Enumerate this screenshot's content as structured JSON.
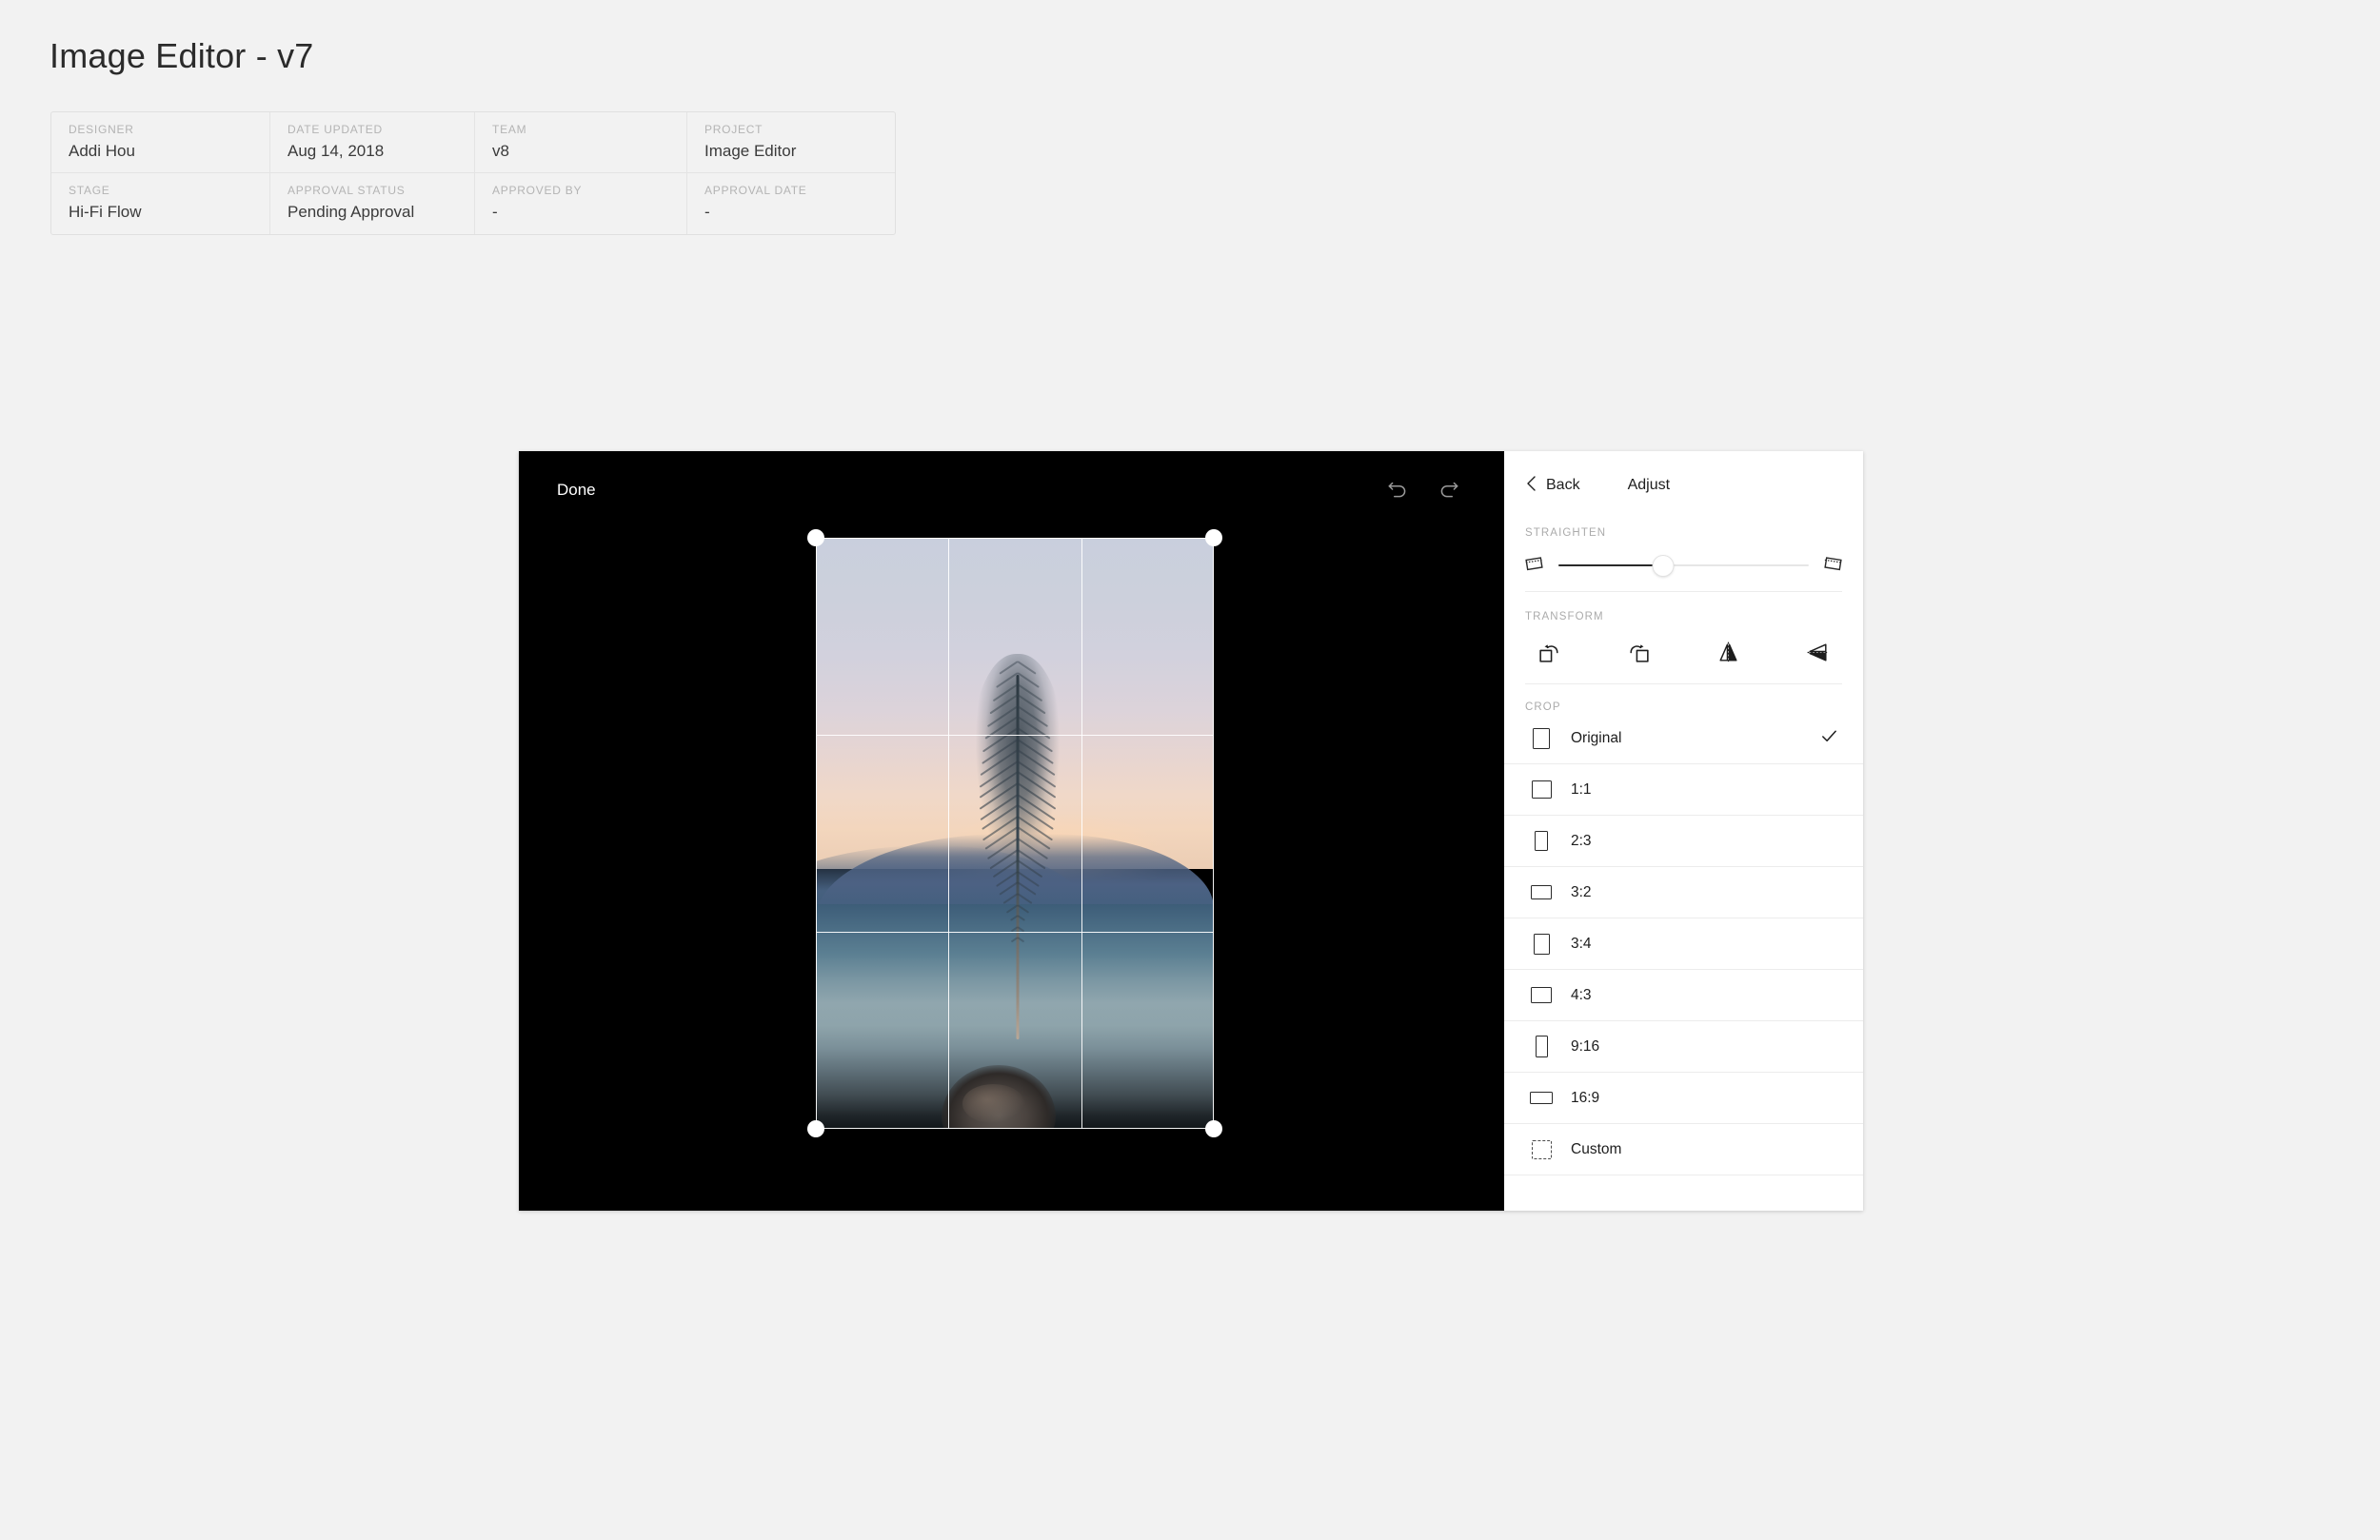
{
  "page": {
    "title": "Image Editor - v7"
  },
  "meta": {
    "rows": [
      [
        {
          "label": "DESIGNER",
          "value": "Addi Hou"
        },
        {
          "label": "DATE UPDATED",
          "value": "Aug 14, 2018"
        },
        {
          "label": "TEAM",
          "value": "v8"
        },
        {
          "label": "PROJECT",
          "value": "Image Editor"
        }
      ],
      [
        {
          "label": "STAGE",
          "value": "Hi-Fi Flow"
        },
        {
          "label": "APPROVAL STATUS",
          "value": "Pending Approval"
        },
        {
          "label": "APPROVED BY",
          "value": "-"
        },
        {
          "label": "APPROVAL DATE",
          "value": "-"
        }
      ]
    ]
  },
  "editor": {
    "canvas": {
      "done_label": "Done",
      "background": "#000000",
      "undo_icon": "undo-icon",
      "redo_icon": "redo-icon",
      "crop_overlay": {
        "grid": "rule-of-thirds",
        "handles": 4,
        "handle_color": "#ffffff",
        "line_color": "#ffffff"
      },
      "photo_subject": "feather held in hand at sunset over water"
    },
    "panel": {
      "back_label": "Back",
      "title": "Adjust",
      "straighten": {
        "label": "STRAIGHTEN",
        "value_percent": 42,
        "left_icon": "rotate-counterclockwise-frame-icon",
        "right_icon": "rotate-clockwise-frame-icon"
      },
      "transform": {
        "label": "TRANSFORM",
        "actions": [
          {
            "name": "rotate-left-icon",
            "title": "Rotate Left"
          },
          {
            "name": "rotate-right-icon",
            "title": "Rotate Right"
          },
          {
            "name": "flip-horizontal-icon",
            "title": "Flip Horizontal"
          },
          {
            "name": "flip-vertical-icon",
            "title": "Flip Vertical"
          }
        ]
      },
      "crop": {
        "label": "CROP",
        "selected": "Original",
        "check_icon": "check-icon",
        "options": [
          {
            "label": "Original",
            "w": 18,
            "h": 22,
            "selected": true,
            "dashed": false
          },
          {
            "label": "1:1",
            "w": 21,
            "h": 19,
            "selected": false,
            "dashed": false
          },
          {
            "label": "2:3",
            "w": 14,
            "h": 21,
            "selected": false,
            "dashed": false
          },
          {
            "label": "3:2",
            "w": 22,
            "h": 15,
            "selected": false,
            "dashed": false
          },
          {
            "label": "3:4",
            "w": 17,
            "h": 22,
            "selected": false,
            "dashed": false
          },
          {
            "label": "4:3",
            "w": 22,
            "h": 17,
            "selected": false,
            "dashed": false
          },
          {
            "label": "9:16",
            "w": 13,
            "h": 23,
            "selected": false,
            "dashed": false
          },
          {
            "label": "16:9",
            "w": 24,
            "h": 13,
            "selected": false,
            "dashed": false
          },
          {
            "label": "Custom",
            "w": 21,
            "h": 20,
            "selected": false,
            "dashed": true
          }
        ]
      }
    }
  },
  "colors": {
    "page_bg": "#f2f2f2",
    "panel_bg": "#ffffff",
    "canvas_bg": "#000000",
    "text_primary": "#1d1d1d",
    "text_muted": "#ababab",
    "divider": "#ececec"
  }
}
